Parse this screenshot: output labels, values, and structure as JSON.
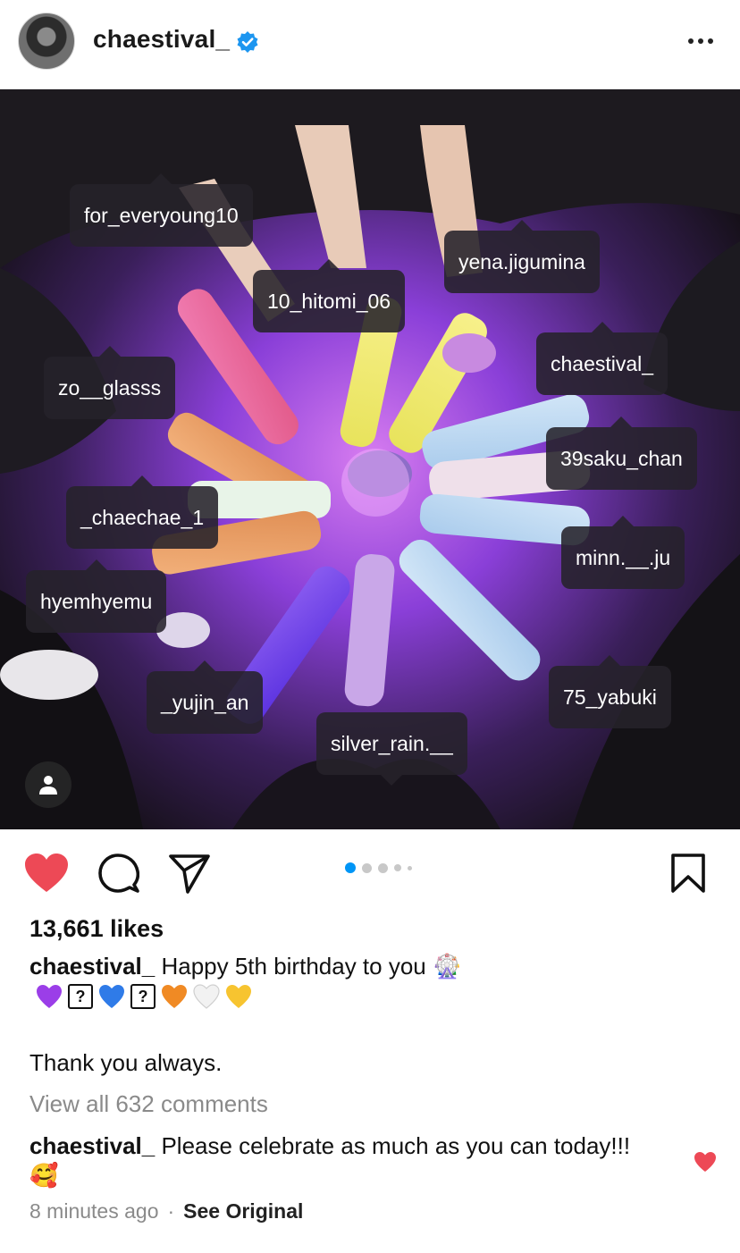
{
  "post": {
    "username": "chaestival_",
    "verified": true,
    "more_icon": "more-horizontal-icon"
  },
  "photo": {
    "alt_colors": {
      "purple": "#7a2be0",
      "pink": "#e86ac4",
      "yellow": "#f2e96a",
      "blue": "#b8d6f0"
    },
    "tags": [
      {
        "label": "for_everyoung10"
      },
      {
        "label": "yena.jigumina"
      },
      {
        "label": "10_hitomi_06"
      },
      {
        "label": "chaestival_"
      },
      {
        "label": "zo__glasss"
      },
      {
        "label": "39saku_chan"
      },
      {
        "label": "_chaechae_1"
      },
      {
        "label": "minn.__.ju"
      },
      {
        "label": "hyemhyemu"
      },
      {
        "label": "_yujin_an"
      },
      {
        "label": "75_yabuki"
      },
      {
        "label": "silver_rain.__"
      }
    ]
  },
  "actions": {
    "like_color": "#ed4956",
    "carousel_count": 5,
    "carousel_active": 1,
    "accent": "#0095f6"
  },
  "likes_text": "13,661 likes",
  "caption": {
    "username": "chaestival_",
    "text": "Happy 5th birthday to you",
    "emoji": "🎡",
    "symbols": [
      "💜",
      "?",
      "💙",
      "?",
      "🧡",
      "🤍",
      "💛"
    ],
    "line2": "Thank you always."
  },
  "view_all": "View all 632 comments",
  "comment": {
    "username": "chaestival_",
    "text": "Please celebrate as much as you can today!!!",
    "emoji": "🥰"
  },
  "meta": {
    "time": "8 minutes ago",
    "separator": "·",
    "see_original": "See Original"
  }
}
